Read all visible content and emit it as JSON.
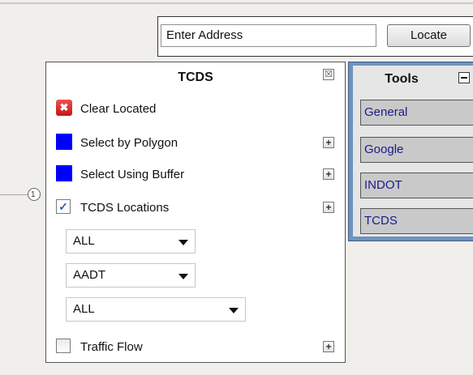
{
  "address_bar": {
    "placeholder": "Enter Address",
    "locate_label": "Locate"
  },
  "map": {
    "marker_text": "1"
  },
  "tcds_panel": {
    "title": "TCDS",
    "close_symbol": "☒",
    "clear_icon_symbol": "✖",
    "clear_label": "Clear Located",
    "select_polygon_label": "Select by Polygon",
    "select_buffer_label": "Select Using Buffer",
    "locations_label": "TCDS Locations",
    "locations_checked": true,
    "check_mark": "✓",
    "plus_symbol": "+",
    "dropdowns": [
      "ALL",
      "AADT",
      "ALL"
    ],
    "traffic_flow_label": "Traffic Flow",
    "traffic_flow_checked": false,
    "accent_color": "#0000ff"
  },
  "tools_panel": {
    "title": "Tools",
    "collapse_symbol": "−",
    "items": [
      "General",
      "Google",
      "INDOT",
      "TCDS"
    ],
    "frame_color": "#6f93be"
  }
}
